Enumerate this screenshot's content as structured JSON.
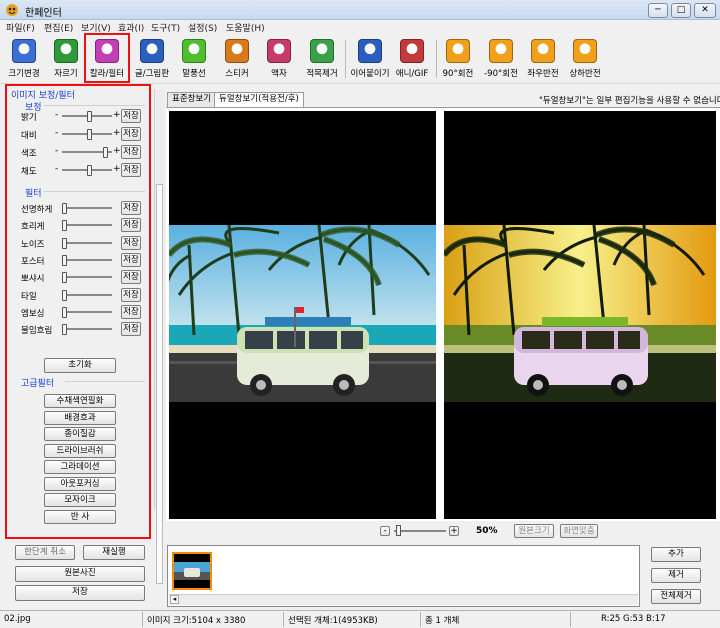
{
  "window": {
    "title": "한페인터",
    "minimize": "─",
    "maximize": "□",
    "close": "✕"
  },
  "menu": [
    "파일(F)",
    "편집(E)",
    "보기(V)",
    "효과(I)",
    "도구(T)",
    "설정(S)",
    "도움말(H)"
  ],
  "toolbar": [
    {
      "label": "크기변경",
      "icon": "resize-icon",
      "color": "#3b6fd6"
    },
    {
      "label": "자르기",
      "icon": "crop-icon",
      "color": "#2f9a3a"
    },
    {
      "label": "칼라/필터",
      "icon": "color-filter-icon",
      "color": "#c23fb5"
    },
    {
      "label": "글/그림판",
      "icon": "text-paint-icon",
      "color": "#2a5fc0"
    },
    {
      "label": "말풍선",
      "icon": "speech-bubble-icon",
      "color": "#4fbf2f"
    },
    {
      "label": "스티커",
      "icon": "sticker-icon",
      "color": "#d97a1a"
    },
    {
      "label": "액자",
      "icon": "frame-icon",
      "color": "#c73a6a"
    },
    {
      "label": "적목제거",
      "icon": "red-eye-icon",
      "color": "#3aa04a"
    },
    {
      "label": "이어붙이기",
      "icon": "merge-icon",
      "color": "#2a5fc0"
    },
    {
      "label": "애니/GIF",
      "icon": "gif-icon",
      "color": "#c23a3a"
    },
    {
      "label": "90°회전",
      "icon": "rotate-cw-icon",
      "color": "#f0a01a"
    },
    {
      "label": "-90°회전",
      "icon": "rotate-ccw-icon",
      "color": "#f0a01a"
    },
    {
      "label": "좌우반전",
      "icon": "flip-horizontal-icon",
      "color": "#f0a01a"
    },
    {
      "label": "상하반전",
      "icon": "flip-vertical-icon",
      "color": "#f0a01a"
    }
  ],
  "left_panel": {
    "title": "이미지 보정/필터",
    "correction_title": "보정",
    "correction": [
      {
        "label": "밝기",
        "value": 0.55
      },
      {
        "label": "대비",
        "value": 0.55
      },
      {
        "label": "색조",
        "value": 0.9
      },
      {
        "label": "채도",
        "value": 0.55
      }
    ],
    "minus": "-",
    "plus": "+",
    "save_label": "저장",
    "filter_title": "필터",
    "filters": [
      {
        "label": "선명하게",
        "value": 0
      },
      {
        "label": "흐리게",
        "value": 0
      },
      {
        "label": "노이즈",
        "value": 0
      },
      {
        "label": "포스터",
        "value": 0
      },
      {
        "label": "뽀샤시",
        "value": 0
      },
      {
        "label": "타일",
        "value": 0
      },
      {
        "label": "엠보싱",
        "value": 0
      },
      {
        "label": "불임흐림",
        "value": 0
      }
    ],
    "reset_label": "초기화",
    "advanced_title": "고급필터",
    "advanced": [
      "수채색연필화",
      "배경흐과",
      "종이질감",
      "드라이브러쉬",
      "그라데이션",
      "아웃포커싱",
      "모자이크",
      "반      사"
    ]
  },
  "tabs": [
    "표준창보기",
    "듀얼창보기(적용전/후)"
  ],
  "dual_note": "\"듀얼창보기\"는 일부 편집기능을 사용할 수 없습니다.",
  "zoom": {
    "value": "50%",
    "original_size": "원본크기",
    "fit_screen": "화면맞춤",
    "minus": "-",
    "plus": "+"
  },
  "bottom_left": {
    "undo": "한단계 취소",
    "redo": "재실행",
    "original": "원본사진",
    "save": "저장"
  },
  "bottom_right": {
    "add": "추가",
    "remove": "제거",
    "remove_all": "전체제거"
  },
  "status": {
    "filename": "02.jpg",
    "size": "이미지 크기:5104 x 3380",
    "selected": "선택된 개체:1(4953KB)",
    "total": "총 1 개체",
    "rgb": "R:25 G:53 B:17"
  }
}
